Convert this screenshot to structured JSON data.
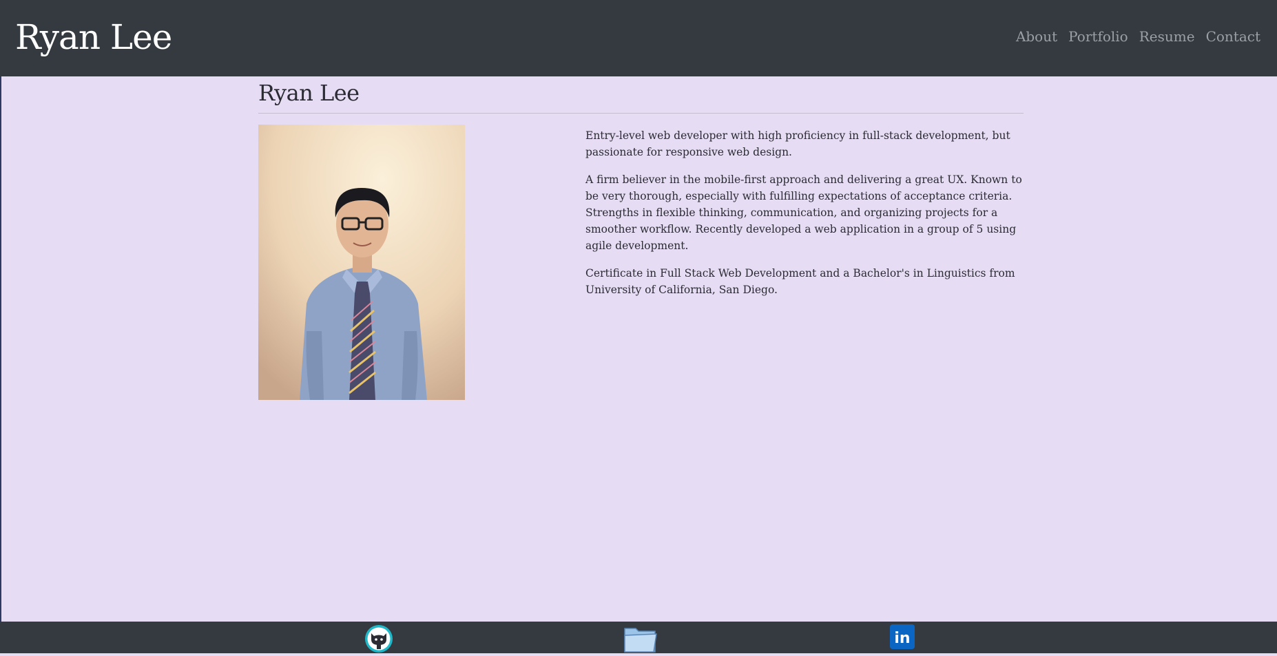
{
  "navbar": {
    "brand": "Ryan Lee",
    "links": [
      {
        "label": "About"
      },
      {
        "label": "Portfolio"
      },
      {
        "label": "Resume"
      },
      {
        "label": "Contact"
      }
    ]
  },
  "main": {
    "title": "Ryan Lee",
    "photo_alt": "Ryan Lee",
    "paragraphs": [
      "Entry-level web developer with high proficiency in full-stack development, but passionate for responsive web design.",
      "A firm believer in the mobile-first approach and delivering a great UX. Known to be very thorough, especially with fulfilling expectations of acceptance criteria. Strengths in flexible thinking, communication, and organizing projects for a smoother workflow. Recently developed a web application in a group of 5 using agile development.",
      "Certificate in Full Stack Web Development and a Bachelor's in Linguistics from University of California, San Diego."
    ]
  },
  "footer": {
    "icons": [
      {
        "name": "github-icon",
        "linkedin_text": ""
      },
      {
        "name": "folder-icon"
      },
      {
        "name": "linkedin-icon",
        "text": "in"
      }
    ]
  },
  "colors": {
    "navbar_bg": "#343a40",
    "page_bg": "#e6ddf4",
    "nav_link": "#9aa0a6",
    "linkedin_blue": "#0a66c2",
    "github_teal": "#1fb8c8"
  }
}
